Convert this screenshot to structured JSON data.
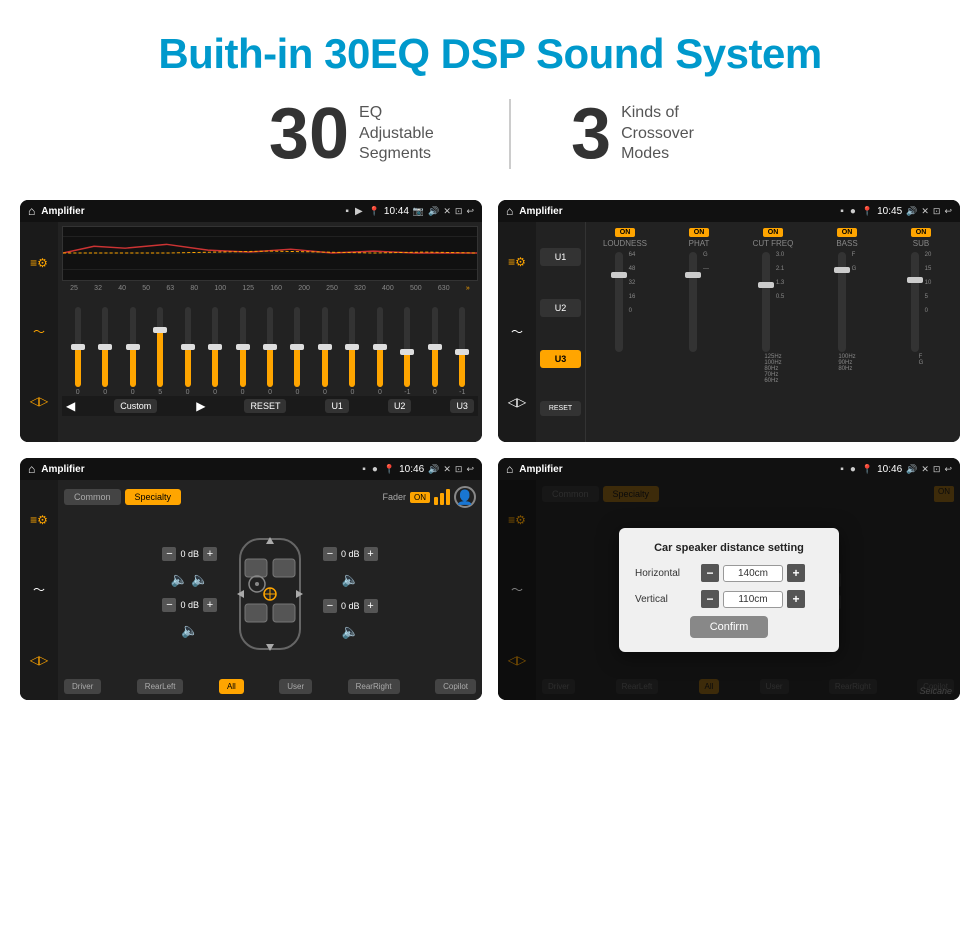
{
  "page": {
    "title": "Buith-in 30EQ DSP Sound System",
    "stats": [
      {
        "number": "30",
        "label": "EQ Adjustable\nSegments"
      },
      {
        "number": "3",
        "label": "Kinds of\nCrossover Modes"
      }
    ]
  },
  "screen_tl": {
    "status": {
      "title": "Amplifier",
      "time": "10:44"
    },
    "eq_labels": [
      "25",
      "32",
      "40",
      "50",
      "63",
      "80",
      "100",
      "125",
      "160",
      "200",
      "250",
      "320",
      "400",
      "500",
      "630"
    ],
    "eq_values": [
      0,
      0,
      0,
      5,
      0,
      0,
      0,
      0,
      0,
      0,
      0,
      0,
      -1,
      0,
      -1
    ],
    "controls": [
      "Custom",
      "RESET",
      "U1",
      "U2",
      "U3"
    ]
  },
  "screen_tr": {
    "status": {
      "title": "Amplifier",
      "time": "10:45"
    },
    "presets": [
      "U1",
      "U2",
      "U3"
    ],
    "channels": [
      {
        "name": "LOUDNESS",
        "on": true
      },
      {
        "name": "PHAT",
        "on": true
      },
      {
        "name": "CUT FREQ",
        "on": true
      },
      {
        "name": "BASS",
        "on": true
      },
      {
        "name": "SUB",
        "on": true
      }
    ],
    "reset_label": "RESET"
  },
  "screen_bl": {
    "status": {
      "title": "Amplifier",
      "time": "10:46"
    },
    "tabs": [
      "Common",
      "Specialty"
    ],
    "fader": {
      "label": "Fader",
      "on": true
    },
    "controls": {
      "top_left": "0 dB",
      "top_right": "0 dB",
      "bottom_left": "0 dB",
      "bottom_right": "0 dB"
    },
    "bottom_btns": [
      "Driver",
      "RearLeft",
      "All",
      "User",
      "RearRight",
      "Copilot"
    ]
  },
  "screen_br": {
    "status": {
      "title": "Amplifier",
      "time": "10:46"
    },
    "tabs": [
      "Common",
      "Specialty"
    ],
    "dialog": {
      "title": "Car speaker distance setting",
      "horizontal_label": "Horizontal",
      "horizontal_value": "140cm",
      "vertical_label": "Vertical",
      "vertical_value": "110cm",
      "confirm_label": "Confirm"
    },
    "bottom_btns": [
      "Driver",
      "RearLeft",
      "All",
      "User",
      "RearRight",
      "Copilot"
    ]
  },
  "watermark": "Seicane"
}
